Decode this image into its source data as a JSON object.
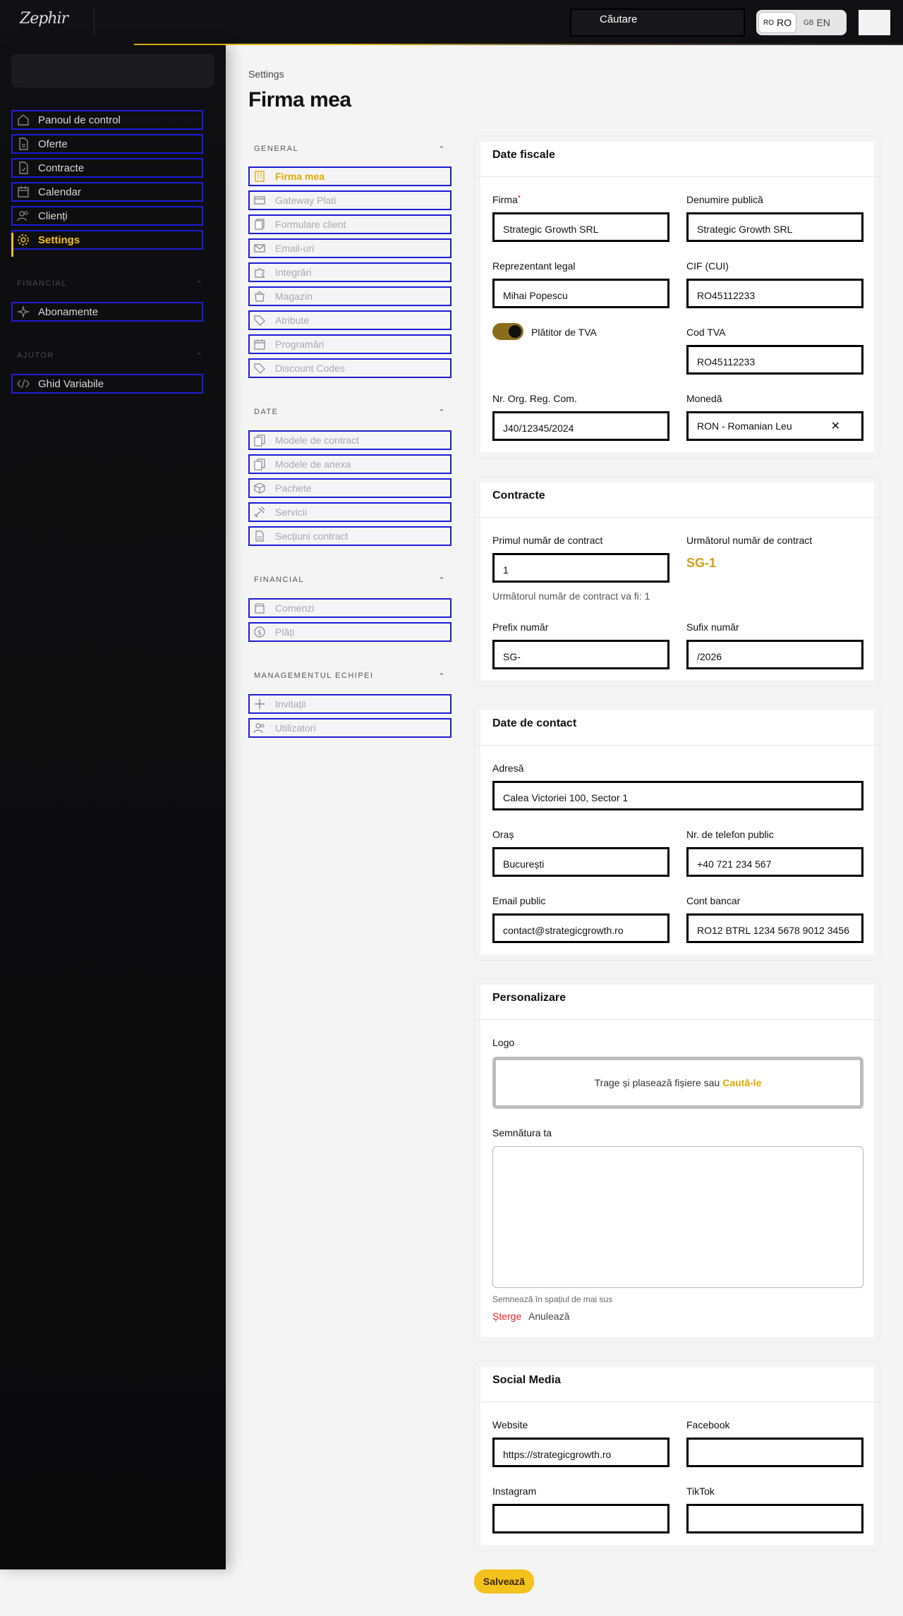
{
  "header": {
    "logo_text": "Zephir",
    "search_label": "Căutare",
    "languages": [
      {
        "code": "RO",
        "label": "RO",
        "active": true
      },
      {
        "code": "GB",
        "label": "EN",
        "active": false
      }
    ]
  },
  "sidebar": {
    "items": [
      {
        "label": "Panoul de control",
        "icon": "home-icon"
      },
      {
        "label": "Oferte",
        "icon": "document-icon"
      },
      {
        "label": "Contracte",
        "icon": "contract-icon"
      },
      {
        "label": "Calendar",
        "icon": "calendar-icon"
      },
      {
        "label": "Clienți",
        "icon": "users-icon"
      },
      {
        "label": "Settings",
        "icon": "gear-icon",
        "active": true
      }
    ],
    "financial_section": "FINANCIAL",
    "financial_items": [
      {
        "label": "Abonamente",
        "icon": "sparkle-icon"
      }
    ],
    "help_section": "AJUTOR",
    "help_items": [
      {
        "label": "Ghid Variabile",
        "icon": "code-icon"
      }
    ]
  },
  "breadcrumb": "Settings",
  "page_title": "Firma mea",
  "subnav": {
    "general": {
      "title": "GENERAL",
      "items": [
        "Firma mea",
        "Gateway Plati",
        "Formulare client",
        "Email-uri",
        "Integrări",
        "Magazin",
        "Atribute",
        "Programări",
        "Discount Codes"
      ]
    },
    "date": {
      "title": "DATE",
      "items": [
        "Modele de contract",
        "Modele de anexa",
        "Pachete",
        "Servicii",
        "Secțiuni contract"
      ]
    },
    "financial": {
      "title": "FINANCIAL",
      "items": [
        "Comenzi",
        "Plăți"
      ]
    },
    "team": {
      "title": "MANAGEMENTUL ECHIPEI",
      "items": [
        "Invitații",
        "Utilizatori"
      ]
    }
  },
  "fiscal": {
    "title": "Date fiscale",
    "firma_label": "Firma",
    "firma_value": "Strategic Growth SRL",
    "public_name_label": "Denumire publică",
    "public_name_value": "Strategic Growth SRL",
    "rep_label": "Reprezentant legal",
    "rep_value": "Mihai Popescu",
    "cif_label": "CIF (CUI)",
    "cif_value": "RO45112233",
    "vat_payer_label": "Plătitor de TVA",
    "vat_payer_on": true,
    "vat_code_label": "Cod TVA",
    "vat_code_value": "RO45112233",
    "reg_label": "Nr. Org. Reg. Com.",
    "reg_value": "J40/12345/2024",
    "currency_label": "Monedă",
    "currency_value": "RON - Romanian Leu"
  },
  "contracts": {
    "title": "Contracte",
    "first_label": "Primul număr de contract",
    "first_value": "1",
    "next_label": "Următorul număr de contract",
    "next_value": "SG-1",
    "next_hint": "Următorul număr de contract va fi: 1",
    "prefix_label": "Prefix număr",
    "prefix_value": "SG-",
    "suffix_label": "Sufix număr",
    "suffix_value": "/2026"
  },
  "contact": {
    "title": "Date de contact",
    "address_label": "Adresă",
    "address_value": "Calea Victoriei 100, Sector 1",
    "city_label": "Oraș",
    "city_value": "București",
    "phone_label": "Nr. de telefon public",
    "phone_value": "+40 721 234 567",
    "email_label": "Email public",
    "email_value": "contact@strategicgrowth.ro",
    "bank_label": "Cont bancar",
    "bank_value": "RO12 BTRL 1234 5678 9012 3456"
  },
  "branding": {
    "title": "Personalizare",
    "logo_label": "Logo",
    "drop_text": "Trage și plasează fișiere sau",
    "drop_link": "Caută-le",
    "signature_label": "Semnătura ta",
    "signature_hint": "Semnează în spațiul de mai sus",
    "clear_label": "Șterge",
    "cancel_label": "Anulează"
  },
  "social": {
    "title": "Social Media",
    "website_label": "Website",
    "website_value": "https://strategicgrowth.ro",
    "facebook_label": "Facebook",
    "facebook_value": "",
    "instagram_label": "Instagram",
    "instagram_value": "",
    "tiktok_label": "TikTok",
    "tiktok_value": ""
  },
  "save_label": "Salvează",
  "colors": {
    "accent": "#f2c11a",
    "sidebar_bg": "#0f0f11",
    "outline": "#1d1dd6"
  }
}
